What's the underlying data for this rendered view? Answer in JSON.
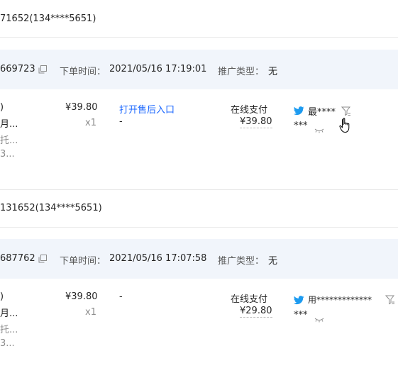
{
  "orders": [
    {
      "account_line": "71652(134****5651)",
      "order_id_tail": "669723",
      "order_time_label": "下单时间：",
      "order_time": "2021/05/16 17:19:01",
      "promo_label": "推广类型：",
      "promo_value": "无",
      "product_frag": [
        ")",
        "月...",
        "托...",
        "3..."
      ],
      "price": "¥39.80",
      "qty": "x1",
      "after_sale": "打开售后入口",
      "after_sale_sub": "-",
      "pay_method": "在线支付",
      "pay_amount": "¥39.80",
      "buyer_name": "最****",
      "buyer_sub": "***"
    },
    {
      "account_line": "131652(134****5651)",
      "order_id_tail": "687762",
      "order_time_label": "下单时间：",
      "order_time": "2021/05/16 17:07:58",
      "promo_label": "推广类型：",
      "promo_value": "无",
      "product_frag": [
        ")",
        "月...",
        "托...",
        "3..."
      ],
      "price": "¥39.80",
      "qty": "x1",
      "after_sale": "-",
      "pay_method": "在线支付",
      "pay_amount": "¥29.80",
      "buyer_name": "用*************",
      "buyer_sub": "***"
    }
  ],
  "colors": {
    "accent": "#1966ff",
    "band": "#f1f5fb",
    "bird": "#1d9bf0"
  },
  "icons": {
    "copy": "copy-icon",
    "bird": "bird-icon",
    "eye": "eye-closed-icon",
    "filter": "filter-icon",
    "cursor": "hand-cursor-icon"
  }
}
